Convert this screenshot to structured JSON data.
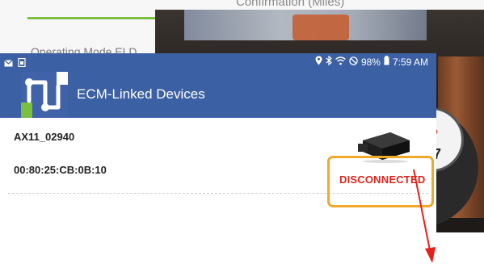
{
  "background": {
    "heading": "Confirmation (Miles)",
    "row_label": "Operating Mode   ELD"
  },
  "photo": {
    "gauge_unit": "D",
    "gauge_value": "7"
  },
  "statusbar": {
    "battery": "98%",
    "time": "7:59 AM",
    "left_icons": [
      "mail-icon",
      "screenshot-icon"
    ],
    "right_icons": [
      "location-icon",
      "bluetooth-icon",
      "wifi-icon",
      "dnd-icon",
      "battery-icon"
    ]
  },
  "appbar": {
    "title": "ECM-Linked Devices",
    "logo": "app-logo-icon"
  },
  "device": {
    "name": "AX11_02940",
    "mac": "00:80:25:CB:0B:10",
    "status": "DISCONNECTED",
    "icon": "ecm-device-icon"
  },
  "colors": {
    "appbar": "#3c60a4",
    "status_disconnected": "#e2231a",
    "highlight": "#f0a92d",
    "arrow": "#e8201a"
  }
}
